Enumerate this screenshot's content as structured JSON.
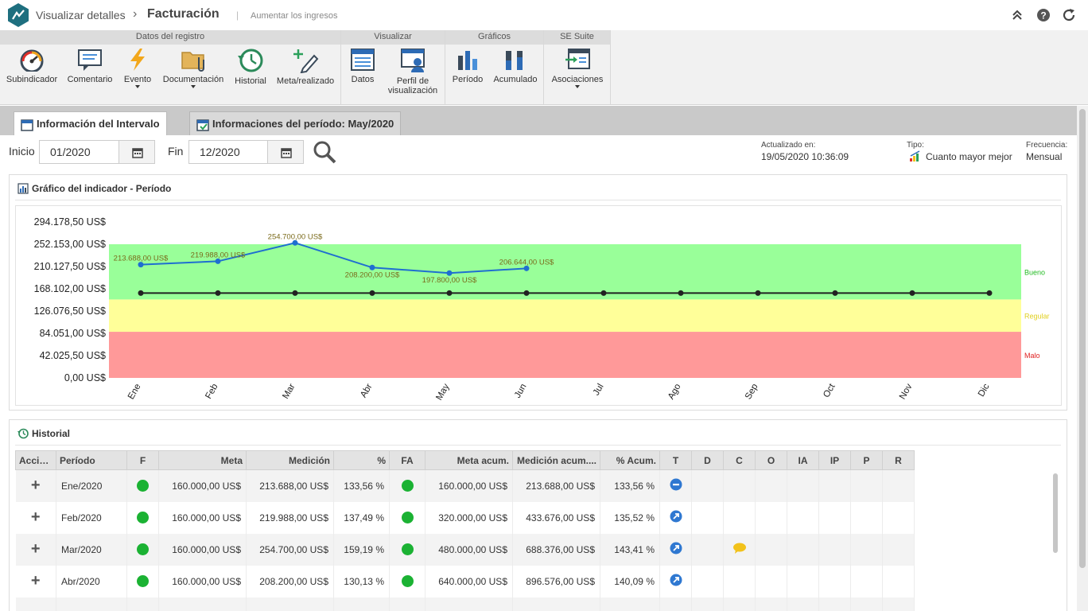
{
  "header": {
    "breadcrumb": "Visualizar detalles",
    "title": "Facturación",
    "separator": "|",
    "subtitle": "Aumentar los ingresos",
    "icons": [
      "collapse-icon",
      "help-icon",
      "refresh-icon"
    ]
  },
  "ribbon": {
    "groups": [
      {
        "title": "Datos del registro",
        "buttons": [
          {
            "label": "Subindicador",
            "icon": "gauge-icon"
          },
          {
            "label": "Comentario",
            "icon": "comment-icon"
          },
          {
            "label": "Evento",
            "icon": "lightning-icon",
            "dropdown": true
          },
          {
            "label": "Documentación",
            "icon": "folder-icon",
            "dropdown": true
          },
          {
            "label": "Historial",
            "icon": "history-icon"
          },
          {
            "label": "Meta/realizado",
            "icon": "pen-plus-icon"
          }
        ]
      },
      {
        "title": "Visualizar",
        "buttons": [
          {
            "label": "Datos",
            "icon": "data-icon"
          },
          {
            "label": "Perfil de visualización",
            "icon": "profile-icon"
          }
        ]
      },
      {
        "title": "Gráficos",
        "buttons": [
          {
            "label": "Período",
            "icon": "bar-chart-icon"
          },
          {
            "label": "Acumulado",
            "icon": "stacked-chart-icon"
          }
        ]
      },
      {
        "title": "SE Suite",
        "buttons": [
          {
            "label": "Asociaciones",
            "icon": "associations-icon",
            "dropdown": true
          }
        ]
      }
    ]
  },
  "tabs": [
    {
      "label": "Información del Intervalo",
      "active": true
    },
    {
      "label": "Informaciones del período: May/2020",
      "active": false
    }
  ],
  "filter": {
    "start_label": "Inicio",
    "start_value": "01/2020",
    "end_label": "Fin",
    "end_value": "12/2020"
  },
  "info": {
    "updated_label": "Actualizado en:",
    "updated_value": "19/05/2020 10:36:09",
    "type_label": "Tipo:",
    "type_value": "Cuanto mayor mejor",
    "freq_label": "Frecuencia:",
    "freq_value": "Mensual"
  },
  "chart_panel": {
    "title": "Gráfico del indicador - Período"
  },
  "chart_data": {
    "type": "line",
    "categories": [
      "Ene",
      "Feb",
      "Mar",
      "Abr",
      "May",
      "Jun",
      "Jul",
      "Ago",
      "Sep",
      "Oct",
      "Nov",
      "Dic"
    ],
    "ylim": [
      0,
      294178.5
    ],
    "yticks": [
      "294.178,50 US$",
      "252.153,00 US$",
      "210.127,50 US$",
      "168.102,00 US$",
      "126.076,50 US$",
      "84.051,00 US$",
      "42.025,50 US$",
      "0,00 US$"
    ],
    "series": [
      {
        "values": [
          213688,
          219988,
          254700,
          208200,
          197800,
          206644
        ],
        "labels": [
          "213.688,00 US$",
          "219.988,00 US$",
          "254.700,00 US$",
          "208.200,00 US$",
          "197.800,00 US$",
          "206.644,00 US$"
        ],
        "color": "#1f6fd0"
      },
      {
        "values": [
          160000,
          160000,
          160000,
          160000,
          160000,
          160000,
          160000,
          160000,
          160000,
          160000,
          160000,
          160000
        ],
        "color": "#222222"
      }
    ],
    "bands": [
      {
        "name": "Malo",
        "from": 0,
        "to": 87000,
        "color": "#ff9999",
        "label_color": "#e02020"
      },
      {
        "name": "Regular",
        "from": 87000,
        "to": 148000,
        "color": "#ffff99",
        "label_color": "#e0d020"
      },
      {
        "name": "Bueno",
        "from": 148000,
        "to": 252153,
        "color": "#99ff99",
        "label_color": "#22bb22"
      }
    ]
  },
  "history_panel": {
    "title": "Historial",
    "columns": [
      "Accio...",
      "Período",
      "F",
      "Meta",
      "Medición",
      "%",
      "FA",
      "Meta acum.",
      "Medición acum....",
      "% Acum.",
      "T",
      "D",
      "C",
      "O",
      "IA",
      "IP",
      "P",
      "R"
    ],
    "rows": [
      {
        "period": "Ene/2020",
        "meta": "160.000,00 US$",
        "medicion": "213.688,00 US$",
        "pct": "133,56 %",
        "meta_acum": "160.000,00 US$",
        "med_acum": "213.688,00 US$",
        "pct_acum": "133,56 %",
        "trend": "minus",
        "comment": false
      },
      {
        "period": "Feb/2020",
        "meta": "160.000,00 US$",
        "medicion": "219.988,00 US$",
        "pct": "137,49 %",
        "meta_acum": "320.000,00 US$",
        "med_acum": "433.676,00 US$",
        "pct_acum": "135,52 %",
        "trend": "up",
        "comment": false
      },
      {
        "period": "Mar/2020",
        "meta": "160.000,00 US$",
        "medicion": "254.700,00 US$",
        "pct": "159,19 %",
        "meta_acum": "480.000,00 US$",
        "med_acum": "688.376,00 US$",
        "pct_acum": "143,41 %",
        "trend": "up",
        "comment": true
      },
      {
        "period": "Abr/2020",
        "meta": "160.000,00 US$",
        "medicion": "208.200,00 US$",
        "pct": "130,13 %",
        "meta_acum": "640.000,00 US$",
        "med_acum": "896.576,00 US$",
        "pct_acum": "140,09 %",
        "trend": "up",
        "comment": false
      }
    ]
  }
}
